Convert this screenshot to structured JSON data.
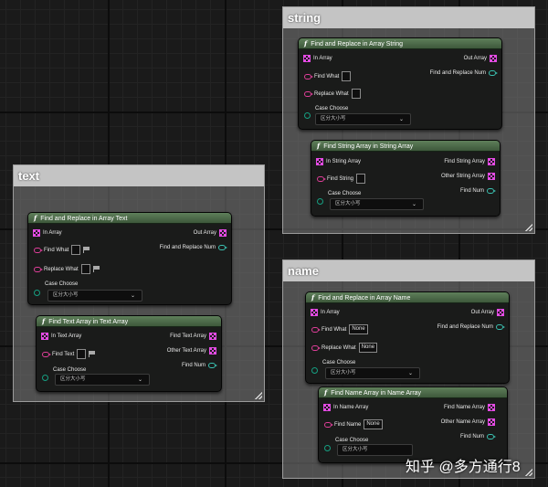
{
  "comments": {
    "text": {
      "title": "text"
    },
    "string": {
      "title": "string"
    },
    "name": {
      "title": "name"
    }
  },
  "nodes": {
    "find_replace_array_text": {
      "title": "Find and Replace in Array Text",
      "in_array": "In Array",
      "find_what": "Find What",
      "replace_what": "Replace What",
      "out_array": "Out Array",
      "find_replace_num": "Find and Replace Num",
      "case_choose": "Case Choose",
      "case_value": "区分大小写"
    },
    "find_text_array": {
      "title": "Find Text Array in Text Array",
      "in_array": "In Text Array",
      "find": "Find Text",
      "out1": "Find Text Array",
      "out2": "Other Text Array",
      "find_num": "Find Num",
      "case_choose": "Case Choose",
      "case_value": "区分大小写"
    },
    "find_replace_array_string": {
      "title": "Find and Replace in Array String",
      "in_array": "In Array",
      "find_what": "Find What",
      "replace_what": "Replace What",
      "out_array": "Out Array",
      "find_replace_num": "Find and Replace Num",
      "case_choose": "Case Choose",
      "case_value": "区分大小写"
    },
    "find_string_array": {
      "title": "Find String Array in String Array",
      "in_array": "In String Array",
      "find": "Find String",
      "out1": "Find String Array",
      "out2": "Other String Array",
      "find_num": "Find Num",
      "case_choose": "Case Choose",
      "case_value": "区分大小写"
    },
    "find_replace_array_name": {
      "title": "Find and Replace in Array Name",
      "in_array": "In Array",
      "find_what": "Find What",
      "find_what_value": "None",
      "replace_what": "Replace What",
      "replace_what_value": "None",
      "out_array": "Out Array",
      "find_replace_num": "Find and Replace Num",
      "case_choose": "Case Choose",
      "case_value": "区分大小写"
    },
    "find_name_array": {
      "title": "Find Name Array in Name Array",
      "in_array": "In Name Array",
      "find": "Find Name",
      "find_value": "None",
      "out1": "Find Name Array",
      "out2": "Other Name Array",
      "find_num": "Find Num",
      "case_choose": "Case Choose",
      "case_value": "区分大小写"
    }
  },
  "watermark": "知乎 @多方通行8",
  "colors": {
    "header_green": "#4f6d4b",
    "array_pin": "#e44be4",
    "text_pin": "#e03e9a",
    "int_pin": "#3ac0b0",
    "enum_pin": "#16a082"
  }
}
